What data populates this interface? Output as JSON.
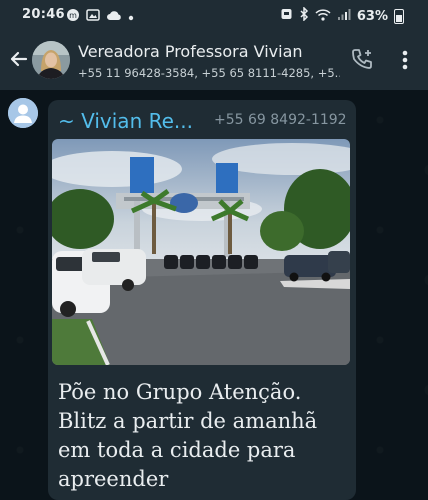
{
  "status_bar": {
    "time": "20:46",
    "battery": "63%"
  },
  "header": {
    "contact_name": "Vereadora Professora Vivian",
    "contact_phones": "+55 11 96428-3584, +55 65 8111-4285, +5..."
  },
  "message": {
    "sender_name": "~ Vivian Re...",
    "sender_phone": "+55 69 8492-1192",
    "text": "Põe no Grupo Atenção. Blitz a partir de amanhã em toda a cidade para apreender"
  },
  "colors": {
    "sender_name": "#53bdeb",
    "header_bg": "#1f2c34",
    "chat_bg": "#0b141a",
    "bubble_bg": "#1f2c34"
  },
  "icons": [
    "back-arrow-icon",
    "add-call-icon",
    "more-vert-icon",
    "person-icon",
    "wifi-icon",
    "bluetooth-icon",
    "battery-icon"
  ]
}
